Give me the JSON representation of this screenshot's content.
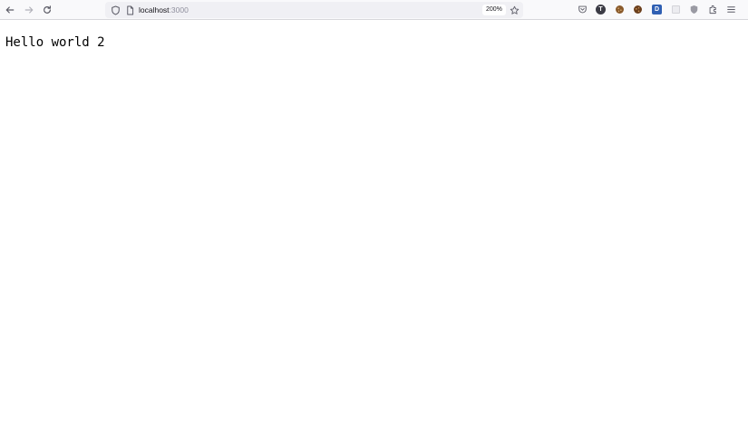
{
  "browser": {
    "nav": {
      "back_icon": "arrow-left-icon",
      "forward_icon": "arrow-right-icon",
      "reload_icon": "reload-icon"
    },
    "urlbar": {
      "host": "localhost",
      "port": ":3000",
      "zoom": "200%",
      "shield_icon": "shield-icon",
      "page_icon": "page-icon",
      "bookmark_icon": "star-icon"
    },
    "extensions": [
      {
        "name": "pocket-icon"
      },
      {
        "name": "extension-t-icon",
        "label": "T"
      },
      {
        "name": "cookie-icon"
      },
      {
        "name": "cookie-alt-icon"
      },
      {
        "name": "extension-d-icon",
        "label": "D"
      },
      {
        "name": "extension-blank-icon"
      },
      {
        "name": "shield-extension-icon"
      },
      {
        "name": "puzzle-icon"
      },
      {
        "name": "hamburger-menu-icon"
      }
    ]
  },
  "page": {
    "text": "Hello world 2"
  },
  "colors": {
    "toolbar_bg": "#f9f9fb",
    "urlbar_bg": "#f0f0f4",
    "icon_color": "#5b5b66",
    "port_color": "#8f8f9d",
    "ext_t_bg": "#3b3b45",
    "ext_cookie_bg": "#8a5a2b",
    "ext_d_bg": "#2f5fb3"
  }
}
